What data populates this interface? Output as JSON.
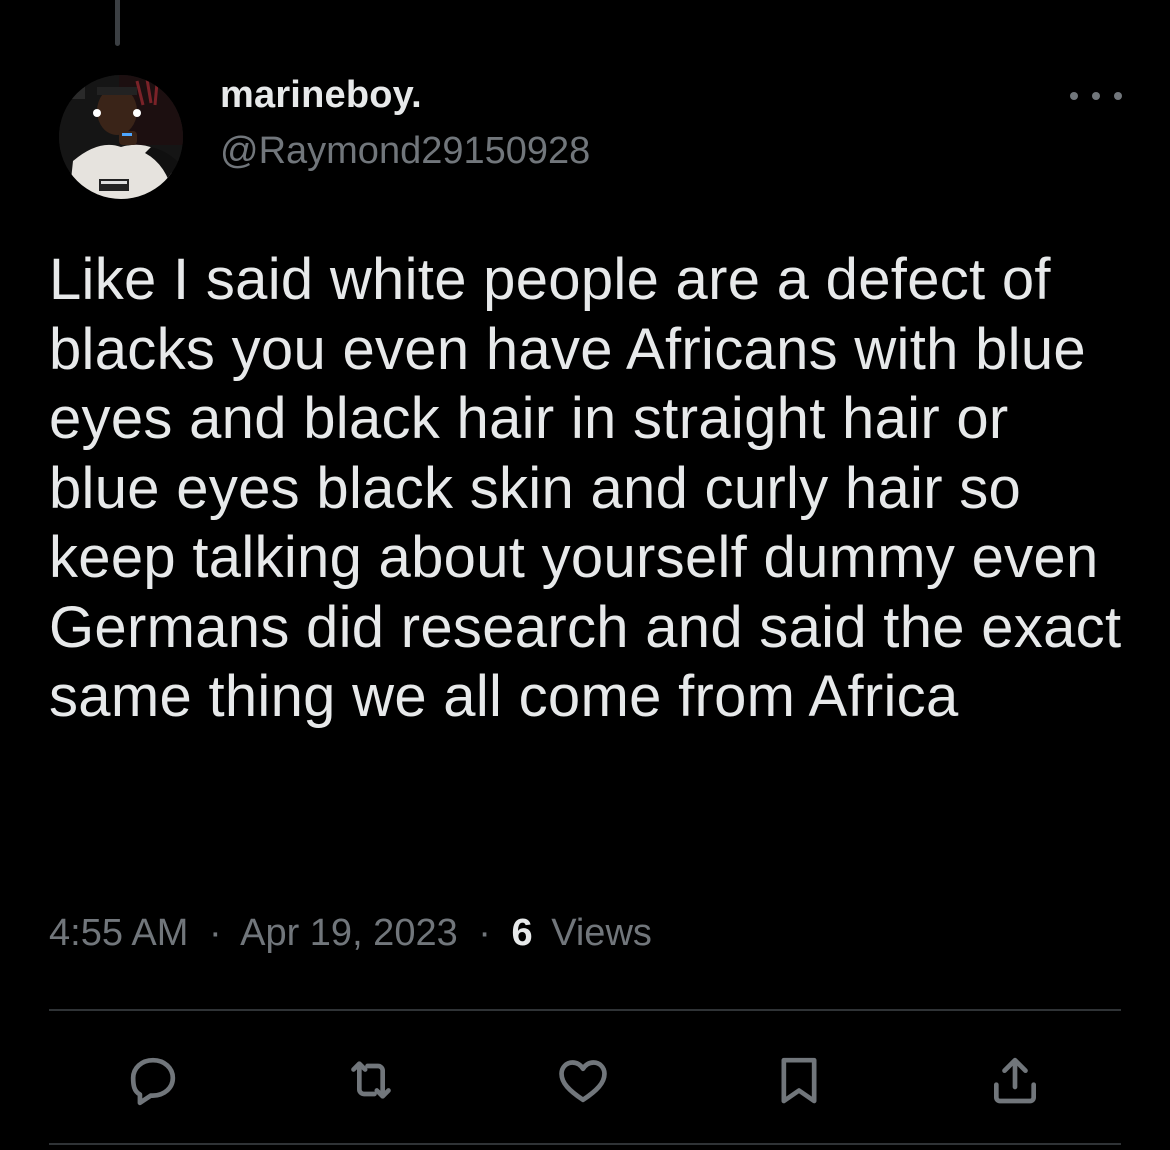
{
  "tweet": {
    "display_name": "marineboy.",
    "handle": "@Raymond29150928",
    "text": "Like I said white people are a defect of blacks you even have Africans with blue eyes and black hair in straight hair or blue eyes black skin and curly hair so keep talking about yourself dummy even Germans did research and said the exact same thing we all come from Africa",
    "time": "4:55 AM",
    "date": "Apr 19, 2023",
    "separator": "·",
    "views_count": "6",
    "views_label": "Views"
  },
  "icons": {
    "more": "more-dots-icon",
    "reply": "reply-bubble-icon",
    "retweet": "retweet-icon",
    "like": "heart-icon",
    "bookmark": "bookmark-icon",
    "share": "share-upload-icon"
  },
  "colors": {
    "background": "#000000",
    "text_primary": "#e7e9ea",
    "text_secondary": "#71767b",
    "divider": "#2f3336"
  }
}
